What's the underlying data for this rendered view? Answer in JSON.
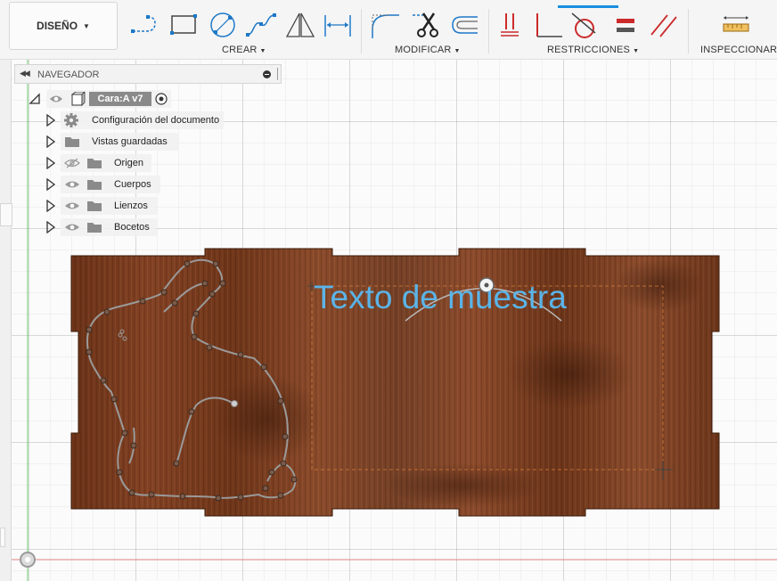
{
  "toolbar": {
    "workspace_button": "DISEÑO",
    "groups": {
      "create": "CREAR",
      "modify": "MODIFICAR",
      "constraints": "RESTRICCIONES",
      "inspect": "INSPECCIONAR"
    },
    "tools": {
      "create": [
        "line-icon",
        "rectangle-icon",
        "circle-icon",
        "spline-icon",
        "mirror-triangle-icon",
        "dimension-icon"
      ],
      "modify": [
        "fillet-icon",
        "trim-scissors-icon",
        "offset-icon"
      ],
      "constraints": [
        "coincident-icon",
        "perpendicular-icon",
        "tangent-icon",
        "equal-icon",
        "parallel-icon"
      ],
      "inspect": [
        "measure-ruler-icon"
      ]
    },
    "accent_color": "#1a8fe0"
  },
  "navigator": {
    "title": "NAVEGADOR",
    "root": "Cara:A v7",
    "items": [
      {
        "label": "Configuración del documento",
        "icon": "gear-icon"
      },
      {
        "label": "Vistas guardadas",
        "icon": "folder-icon"
      },
      {
        "label": "Origen",
        "icon": "folder-icon",
        "visibility": "hidden"
      },
      {
        "label": "Cuerpos",
        "icon": "folder-icon",
        "visibility": "visible"
      },
      {
        "label": "Lienzos",
        "icon": "folder-icon",
        "visibility": "visible"
      },
      {
        "label": "Bocetos",
        "icon": "folder-icon",
        "visibility": "visible"
      }
    ]
  },
  "canvas": {
    "sketch_text": "Texto de muestra",
    "sketch_text_color": "#5ab4e8",
    "sketch_line_color": "#9a9a9a",
    "wood_color": "#7a3e22"
  }
}
